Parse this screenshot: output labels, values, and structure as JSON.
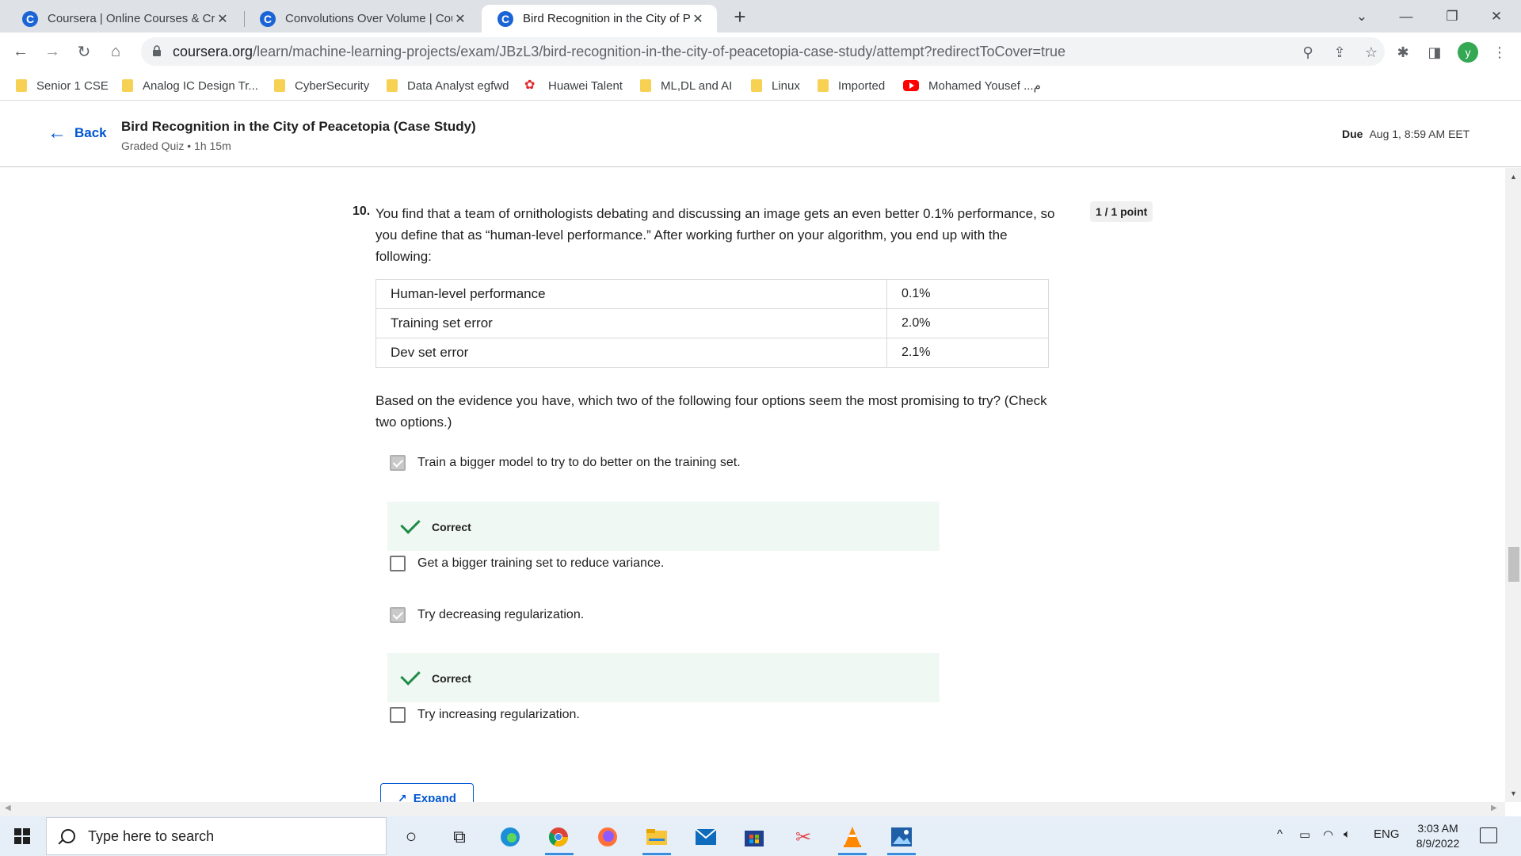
{
  "browser": {
    "tabs": [
      {
        "title": "Coursera | Online Courses & Cred",
        "favicon": "C"
      },
      {
        "title": "Convolutions Over Volume | Cou",
        "favicon": "C"
      },
      {
        "title": "Bird Recognition in the City of Pe",
        "favicon": "C"
      }
    ],
    "active_tab_index": 2,
    "url_host": "coursera.org",
    "url_path": "/learn/machine-learning-projects/exam/JBzL3/bird-recognition-in-the-city-of-peacetopia-case-study/attempt?redirectToCover=true",
    "profile_initial": "y",
    "bookmarks": [
      {
        "label": "Senior 1 CSE",
        "icon": "folder-icon"
      },
      {
        "label": "Analog IC Design Tr...",
        "icon": "folder-icon"
      },
      {
        "label": "CyberSecurity",
        "icon": "folder-icon"
      },
      {
        "label": "Data Analyst egfwd",
        "icon": "folder-icon"
      },
      {
        "label": "Huawei Talent",
        "icon": "huawei-icon"
      },
      {
        "label": "ML,DL and AI",
        "icon": "folder-icon"
      },
      {
        "label": "Linux",
        "icon": "folder-icon"
      },
      {
        "label": "Imported",
        "icon": "folder-icon"
      },
      {
        "label": "Mohamed Yousef ...م",
        "icon": "youtube-icon"
      }
    ]
  },
  "header": {
    "back_label": "Back",
    "title": "Bird Recognition in the City of Peacetopia (Case Study)",
    "subtitle": "Graded Quiz • 1h 15m",
    "due_label": "Due",
    "due_value": "Aug 1, 8:59 AM EET"
  },
  "question": {
    "number": "10.",
    "text": "You find that a team of ornithologists debating and discussing an image gets an even better 0.1% performance, so you define that as “human-level performance.” After working further on your algorithm, you end up with the following:",
    "points": "1 / 1 point",
    "table": [
      {
        "label": "Human-level performance",
        "value": "0.1%"
      },
      {
        "label": "Training set error",
        "value": "2.0%"
      },
      {
        "label": "Dev set error",
        "value": "2.1%"
      }
    ],
    "prompt": "Based on the evidence you have, which two of the following four options seem the most promising to try? (Check two options.)",
    "options": [
      {
        "label": "Train a bigger model to try to do better on the training set.",
        "checked": true,
        "feedback": "Correct"
      },
      {
        "label": "Get a bigger training set to reduce variance.",
        "checked": false,
        "feedback": ""
      },
      {
        "label": "Try decreasing regularization.",
        "checked": true,
        "feedback": "Correct"
      },
      {
        "label": "Try increasing regularization.",
        "checked": false,
        "feedback": ""
      }
    ],
    "expand_label": "Expand"
  },
  "taskbar": {
    "search_placeholder": "Type here to search",
    "language": "ENG",
    "time": "3:03 AM",
    "date": "8/9/2022"
  },
  "colors": {
    "link_blue": "#0056d2",
    "correct_green": "#1e8c45",
    "feedback_bg": "#f0f8f4"
  }
}
